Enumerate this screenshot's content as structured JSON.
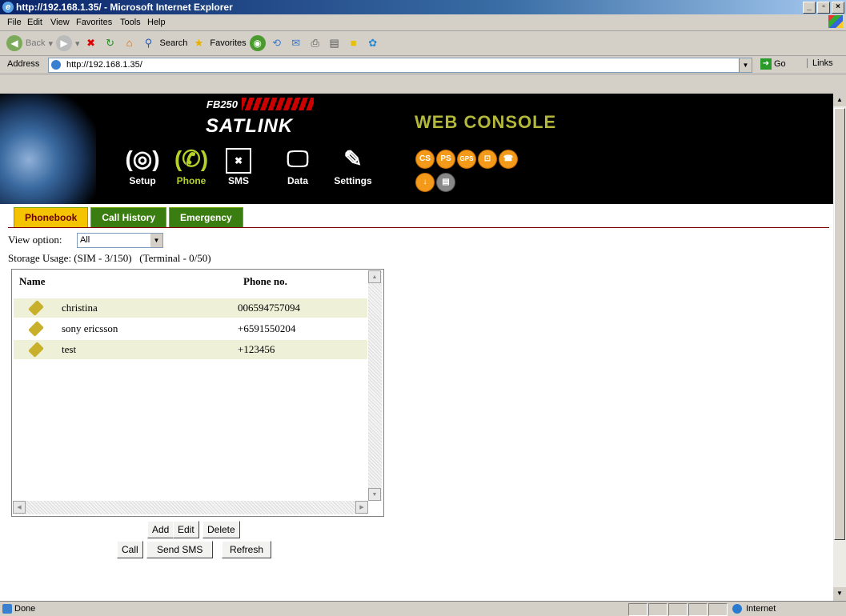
{
  "window": {
    "title": "http://192.168.1.35/ - Microsoft Internet Explorer",
    "controls": [
      "_",
      "▫",
      "×"
    ]
  },
  "menu": [
    "File",
    "Edit",
    "View",
    "Favorites",
    "Tools",
    "Help"
  ],
  "toolbar": {
    "back": "Back",
    "search": "Search",
    "favorites": "Favorites"
  },
  "address": {
    "label": "Address",
    "url": "http://192.168.1.35/",
    "go": "Go",
    "links": "Links"
  },
  "banner": {
    "model": "FB250",
    "brand": "SATLINK",
    "console": "WEB CONSOLE",
    "nav": [
      "Setup",
      "Phone",
      "SMS",
      "Data",
      "Settings"
    ],
    "orbs": [
      "CS",
      "PS",
      "GPS",
      "⊡",
      "☎",
      "↓",
      "▤"
    ]
  },
  "tabs": [
    "Phonebook",
    "Call History",
    "Emergency"
  ],
  "view_option": {
    "label": "View option:",
    "value": "All"
  },
  "storage": {
    "text": "Storage Usage: (SIM - 3/150)",
    "terminal": "(Terminal - 0/50)"
  },
  "table": {
    "headers": [
      "Name",
      "Phone no."
    ],
    "rows": [
      {
        "name": "christina",
        "phone": "006594757094"
      },
      {
        "name": "sony ericsson",
        "phone": "+6591550204"
      },
      {
        "name": "test",
        "phone": "+123456"
      }
    ]
  },
  "buttons": {
    "add": "Add",
    "edit": "Edit",
    "delete": "Delete",
    "call": "Call",
    "send_sms": "Send SMS",
    "refresh": "Refresh"
  },
  "status": {
    "text": "Done",
    "zone": "Internet"
  }
}
